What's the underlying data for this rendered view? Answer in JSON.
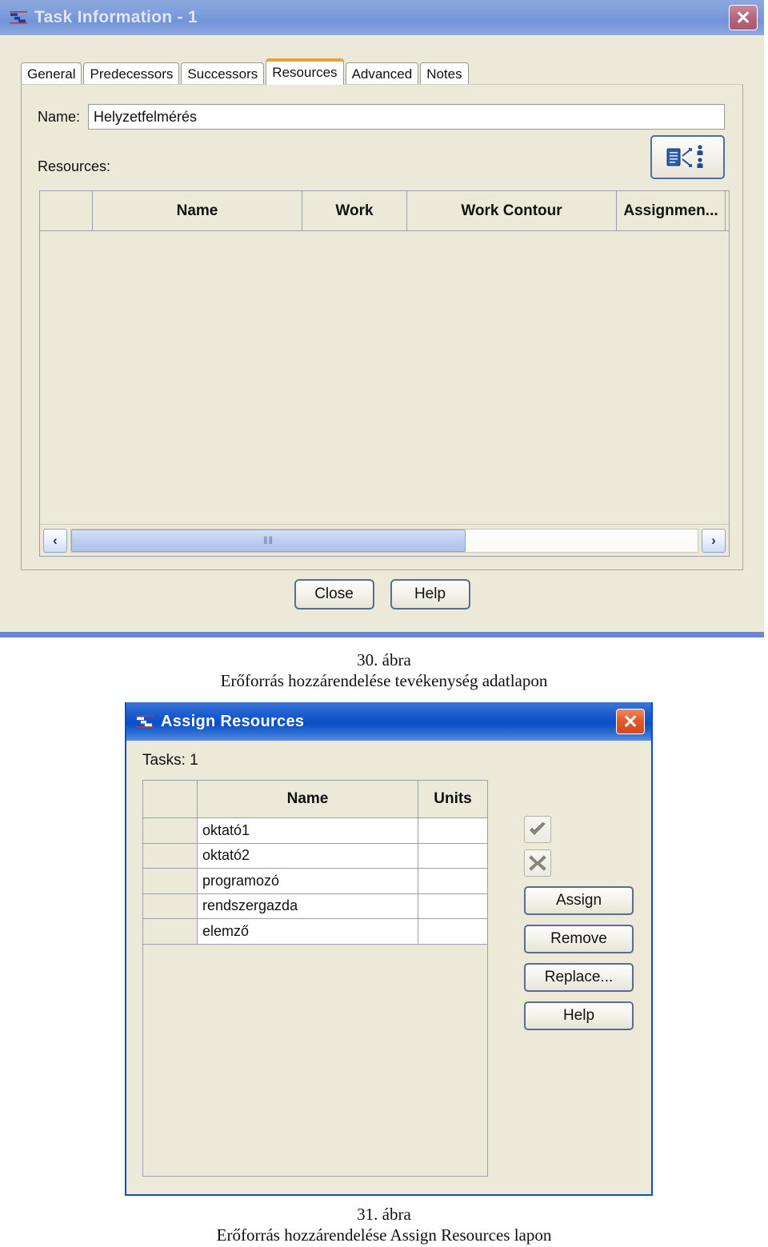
{
  "task_dialog": {
    "title": "Task Information - 1",
    "app_icon": "project-gantt-icon",
    "close_label": "✕",
    "tabs": [
      {
        "label": "General",
        "active": false
      },
      {
        "label": "Predecessors",
        "active": false
      },
      {
        "label": "Successors",
        "active": false
      },
      {
        "label": "Resources",
        "active": true
      },
      {
        "label": "Advanced",
        "active": false
      },
      {
        "label": "Notes",
        "active": false
      }
    ],
    "name_label": "Name:",
    "name_value": "Helyzetfelmérés",
    "resources_label": "Resources:",
    "assign_icon_button": "assign-resources-icon",
    "grid": {
      "columns": [
        "",
        "Name",
        "Work",
        "Work Contour",
        "Assignmen...",
        ""
      ],
      "rows": []
    },
    "scrollbar": {
      "left_arrow": "‹",
      "right_arrow": "›",
      "grip": "‖‖"
    },
    "buttons": [
      {
        "label": "Close"
      },
      {
        "label": "Help"
      }
    ],
    "colors": {
      "titlebar": "#7e9ddb",
      "face": "#ece9d8",
      "active_tab_accent": "#e8a33d",
      "close_button": "#b4667a"
    }
  },
  "caption_30": {
    "line1": "30. ábra",
    "line2": "Erőforrás hozzárendelése tevékenység adatlapon"
  },
  "assign_dialog": {
    "title": "Assign Resources",
    "app_icon": "project-gantt-icon",
    "close_label": "✕",
    "tasks_line": "Tasks: 1",
    "grid": {
      "columns": [
        "",
        "Name",
        "Units"
      ],
      "rows": [
        {
          "select": "",
          "name": "oktató1",
          "units": ""
        },
        {
          "select": "",
          "name": "oktató2",
          "units": ""
        },
        {
          "select": "",
          "name": "programozó",
          "units": ""
        },
        {
          "select": "",
          "name": "rendszergazda",
          "units": ""
        },
        {
          "select": "",
          "name": "elemző",
          "units": ""
        }
      ]
    },
    "icon_buttons": [
      {
        "name": "confirm-check-icon"
      },
      {
        "name": "cancel-x-icon"
      }
    ],
    "buttons": [
      {
        "label": "Assign"
      },
      {
        "label": "Remove"
      },
      {
        "label": "Replace..."
      },
      {
        "label": "Help"
      }
    ],
    "colors": {
      "titlebar": "#0a4ec6",
      "face": "#ece9d8",
      "close_button": "#e4562a"
    }
  },
  "caption_31": {
    "line1": "31. ábra",
    "line2": "Erőforrás hozzárendelése Assign Resources lapon"
  }
}
